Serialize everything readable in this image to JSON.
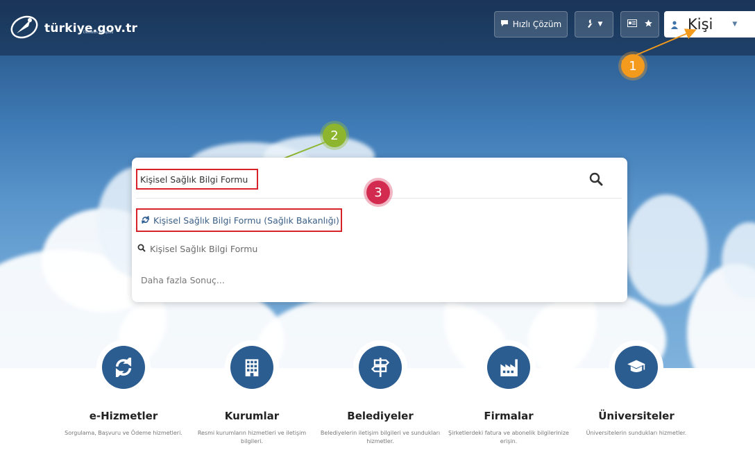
{
  "header": {
    "logo_text": "türkiye.gov.tr",
    "logo_tagline": "Devletin Kısayolu",
    "quick_solution_label": "Hızlı Çözüm",
    "user_label": "Kişi"
  },
  "markers": {
    "one": "1",
    "two": "2",
    "three": "3"
  },
  "search": {
    "value": "Kişisel Sağlık Bilgi Formu",
    "results": [
      {
        "label": "Kişisel Sağlık Bilgi Formu (Sağlık Bakanlığı)",
        "icon": "refresh-icon",
        "highlighted": true
      },
      {
        "label": "Kişisel Sağlık Bilgi Formu",
        "icon": "search-icon",
        "highlighted": false
      }
    ],
    "more_label": "Daha fazla Sonuç..."
  },
  "categories": [
    {
      "title": "e-Hizmetler",
      "desc": "Sorgulama, Başvuru ve Ödeme hizmetleri.",
      "icon": "refresh-icon"
    },
    {
      "title": "Kurumlar",
      "desc": "Resmi kurumların hizmetleri ve iletişim bilgileri.",
      "icon": "building-icon"
    },
    {
      "title": "Belediyeler",
      "desc": "Belediyelerin iletişim bilgileri ve sundukları hizmetler.",
      "icon": "signpost-icon"
    },
    {
      "title": "Firmalar",
      "desc": "Şirketlerdeki fatura ve abonelik bilgilerinize erişin.",
      "icon": "factory-icon"
    },
    {
      "title": "Üniversiteler",
      "desc": "Üniversitelerin sundukları hizmetler.",
      "icon": "graduation-cap-icon"
    }
  ],
  "colors": {
    "brand_blue": "#2c5d91",
    "highlight_red": "#d8222a",
    "marker_orange": "#f49a1c",
    "marker_green": "#8db52e",
    "marker_pink": "#d22b4f"
  }
}
